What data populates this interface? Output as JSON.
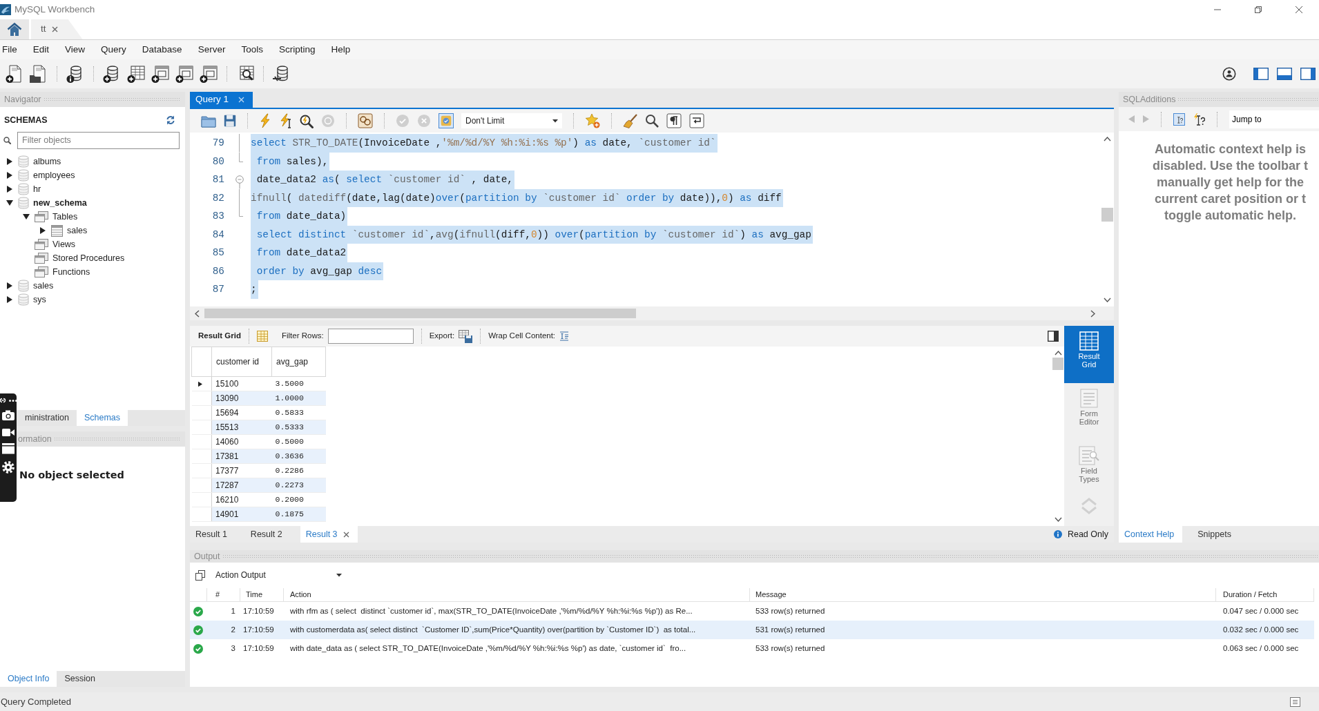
{
  "window": {
    "title": "MySQL Workbench"
  },
  "connection_tabs": [
    {
      "label": "tt",
      "selected": true
    }
  ],
  "menu": [
    "File",
    "Edit",
    "View",
    "Query",
    "Database",
    "Server",
    "Tools",
    "Scripting",
    "Help"
  ],
  "layout_toggles": [
    {
      "kind": "left",
      "on": true
    },
    {
      "kind": "bottom",
      "on": true
    },
    {
      "kind": "right",
      "on": true
    }
  ],
  "navigator": {
    "title": "Navigator",
    "section": "SCHEMAS",
    "filter": {
      "placeholder": "Filter objects"
    },
    "tree": [
      {
        "label": "albums",
        "kind": "schema",
        "expanded": false,
        "default": false
      },
      {
        "label": "employees",
        "kind": "schema",
        "expanded": false,
        "default": false
      },
      {
        "label": "hr",
        "kind": "schema",
        "expanded": false,
        "default": false
      },
      {
        "label": "new_schema",
        "kind": "schema",
        "expanded": true,
        "default": true,
        "children": [
          {
            "label": "Tables",
            "kind": "folder",
            "expanded": true,
            "children": [
              {
                "label": "sales",
                "kind": "table",
                "expanded": false
              }
            ]
          },
          {
            "label": "Views",
            "kind": "folder"
          },
          {
            "label": "Stored Procedures",
            "kind": "folder"
          },
          {
            "label": "Functions",
            "kind": "folder"
          }
        ]
      },
      {
        "label": "sales",
        "kind": "schema",
        "expanded": false,
        "default": false
      },
      {
        "label": "sys",
        "kind": "schema",
        "expanded": false,
        "default": false
      }
    ]
  },
  "sidebar_tabs": [
    {
      "label": "ministration",
      "selected": false
    },
    {
      "label": "Schemas",
      "selected": true
    }
  ],
  "information": {
    "title": "ormation",
    "message": "No object selected"
  },
  "info_tabs": [
    {
      "label": "Object Info",
      "selected": true
    },
    {
      "label": "Session",
      "selected": false
    }
  ],
  "query_tabs": [
    {
      "label": "Query 1",
      "selected": true
    }
  ],
  "editor_toolbar": {
    "stop_disabled": true,
    "commit_disabled": true,
    "rollback_disabled": true,
    "autocommit": true,
    "limit": "Don't Limit"
  },
  "editor": {
    "lines": [
      {
        "number": "79",
        "fold": {
          "kind": "inner"
        },
        "selected": true,
        "tokens": [
          {
            "kind": "keyword",
            "text": "select "
          },
          {
            "kind": "function",
            "text": "STR_TO_DATE"
          },
          {
            "kind": "plain",
            "text": "(InvoiceDate ,"
          },
          {
            "kind": "string",
            "text": "'%m/%d/%Y %h:%i:%s %p'"
          },
          {
            "kind": "plain",
            "text": ") "
          },
          {
            "kind": "keyword",
            "text": "as"
          },
          {
            "kind": "plain",
            "text": " date, "
          },
          {
            "kind": "identifier",
            "text": "`customer id`"
          }
        ]
      },
      {
        "number": "80",
        "fold": {
          "kind": "end"
        },
        "selected": true,
        "tokens": [
          {
            "kind": "keyword",
            "text": " from"
          },
          {
            "kind": "plain",
            "text": " sales),"
          }
        ]
      },
      {
        "number": "81",
        "fold": {
          "kind": "start"
        },
        "selected": true,
        "tokens": [
          {
            "kind": "plain",
            "text": " date_data2 "
          },
          {
            "kind": "keyword",
            "text": "as"
          },
          {
            "kind": "plain",
            "text": "( "
          },
          {
            "kind": "keyword",
            "text": "select "
          },
          {
            "kind": "identifier",
            "text": "`customer id`"
          },
          {
            "kind": "plain",
            "text": " , date,"
          }
        ]
      },
      {
        "number": "82",
        "fold": {
          "kind": "inner"
        },
        "selected": true,
        "tokens": [
          {
            "kind": "function",
            "text": "ifnull"
          },
          {
            "kind": "plain",
            "text": "( "
          },
          {
            "kind": "function",
            "text": "datediff"
          },
          {
            "kind": "plain",
            "text": "(date,lag(date)"
          },
          {
            "kind": "keyword",
            "text": "over"
          },
          {
            "kind": "plain",
            "text": "("
          },
          {
            "kind": "keyword",
            "text": "partition by "
          },
          {
            "kind": "identifier",
            "text": "`customer id`"
          },
          {
            "kind": "keyword",
            "text": " order by"
          },
          {
            "kind": "plain",
            "text": " date)),"
          },
          {
            "kind": "number",
            "text": "0"
          },
          {
            "kind": "plain",
            "text": ") "
          },
          {
            "kind": "keyword",
            "text": "as"
          },
          {
            "kind": "plain",
            "text": " diff"
          }
        ]
      },
      {
        "number": "83",
        "fold": {
          "kind": "end"
        },
        "selected": true,
        "tokens": [
          {
            "kind": "keyword",
            "text": " from"
          },
          {
            "kind": "plain",
            "text": " date_data)"
          }
        ]
      },
      {
        "number": "84",
        "selected": true,
        "tokens": [
          {
            "kind": "keyword",
            "text": " select distinct "
          },
          {
            "kind": "identifier",
            "text": "`customer id`"
          },
          {
            "kind": "plain",
            "text": ","
          },
          {
            "kind": "function",
            "text": "avg"
          },
          {
            "kind": "plain",
            "text": "("
          },
          {
            "kind": "function",
            "text": "ifnull"
          },
          {
            "kind": "plain",
            "text": "(diff,"
          },
          {
            "kind": "number",
            "text": "0"
          },
          {
            "kind": "plain",
            "text": ")) "
          },
          {
            "kind": "keyword",
            "text": "over"
          },
          {
            "kind": "plain",
            "text": "("
          },
          {
            "kind": "keyword",
            "text": "partition by "
          },
          {
            "kind": "identifier",
            "text": "`customer id`"
          },
          {
            "kind": "plain",
            "text": ") "
          },
          {
            "kind": "keyword",
            "text": "as"
          },
          {
            "kind": "plain",
            "text": " avg_gap"
          }
        ]
      },
      {
        "number": "85",
        "selected": true,
        "tokens": [
          {
            "kind": "keyword",
            "text": " from"
          },
          {
            "kind": "plain",
            "text": " date_data2"
          }
        ]
      },
      {
        "number": "86",
        "selected": true,
        "tokens": [
          {
            "kind": "keyword",
            "text": " order by"
          },
          {
            "kind": "plain",
            "text": " avg_gap "
          },
          {
            "kind": "keyword",
            "text": "desc"
          }
        ]
      },
      {
        "number": "87",
        "selected": true,
        "tokens": [
          {
            "kind": "plain",
            "text": ";"
          }
        ]
      }
    ]
  },
  "result": {
    "toolbar": {
      "grid_label": "Result Grid",
      "filter_label": "Filter Rows:",
      "export_label": "Export:",
      "wrap_label": "Wrap Cell Content:"
    },
    "columns": [
      {
        "label": "customer id",
        "kind": "integer"
      },
      {
        "label": "avg_gap",
        "kind": "decimal"
      }
    ],
    "rows": [
      {
        "cells": [
          "15100",
          "3.5000"
        ],
        "selected": true
      },
      {
        "cells": [
          "13090",
          "1.0000"
        ],
        "selected": false
      },
      {
        "cells": [
          "15694",
          "0.5833"
        ],
        "selected": false
      },
      {
        "cells": [
          "15513",
          "0.5333"
        ],
        "selected": false
      },
      {
        "cells": [
          "14060",
          "0.5000"
        ],
        "selected": false
      },
      {
        "cells": [
          "17381",
          "0.3636"
        ],
        "selected": false
      },
      {
        "cells": [
          "17377",
          "0.2286"
        ],
        "selected": false
      },
      {
        "cells": [
          "17287",
          "0.2273"
        ],
        "selected": false
      },
      {
        "cells": [
          "16210",
          "0.2000"
        ],
        "selected": false
      },
      {
        "cells": [
          "14901",
          "0.1875"
        ],
        "selected": false
      }
    ],
    "views": [
      {
        "label": "Result Grid",
        "kind": "grid",
        "selected": true
      },
      {
        "label": "Form Editor",
        "kind": "form",
        "selected": false
      },
      {
        "label": "Field Types",
        "kind": "fields",
        "selected": false
      }
    ],
    "tabs": [
      {
        "label": "Result 1",
        "selected": false
      },
      {
        "label": "Result 2",
        "selected": false
      },
      {
        "label": "Result 3",
        "selected": true
      }
    ],
    "status": "Read Only"
  },
  "sql_additions": {
    "title": "SQLAdditions",
    "back_disabled": true,
    "forward_disabled": true,
    "manual_help_pressed": true,
    "jump_to": "Jump to",
    "help_lines": [
      "Automatic context help is",
      "disabled. Use the toolbar t",
      "manually get help for the",
      "current caret position or t",
      "toggle automatic help."
    ],
    "tabs": [
      {
        "label": "Context Help",
        "selected": true
      },
      {
        "label": "Snippets",
        "selected": false
      }
    ]
  },
  "output": {
    "title": "Output",
    "mode": "Action Output",
    "columns": [
      "#",
      "Time",
      "Action",
      "Message",
      "Duration / Fetch"
    ],
    "rows": [
      {
        "succeeded": true,
        "number": "1",
        "time": "17:10:59",
        "action": "with rfm as ( select  distinct `customer id`, max(STR_TO_DATE(InvoiceDate ,'%m/%d/%Y %h:%i:%s %p')) as Re...",
        "message": "533 row(s) returned",
        "duration": "0.047 sec / 0.000 sec",
        "selected": false
      },
      {
        "succeeded": true,
        "number": "2",
        "time": "17:10:59",
        "action": "with customerdata as( select distinct  `Customer ID`,sum(Price*Quantity) over(partition by `Customer ID`)  as total...",
        "message": "531 row(s) returned",
        "duration": "0.032 sec / 0.000 sec",
        "selected": true
      },
      {
        "succeeded": true,
        "number": "3",
        "time": "17:10:59",
        "action": "with date_data as ( select STR_TO_DATE(InvoiceDate ,'%m/%d/%Y %h:%i:%s %p') as date, `customer id`  fro...",
        "message": "533 row(s) returned",
        "duration": "0.063 sec / 0.000 sec",
        "selected": false
      }
    ]
  },
  "status_bar": {
    "text": "Query Completed"
  }
}
